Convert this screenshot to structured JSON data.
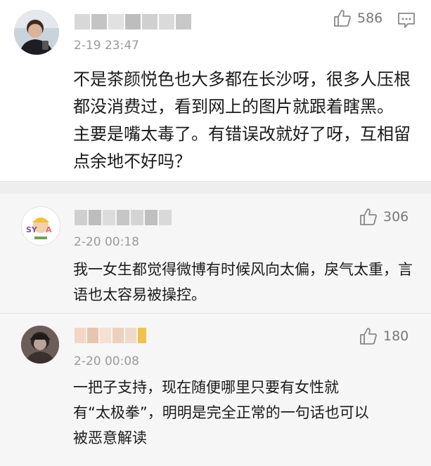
{
  "main_comment": {
    "time": "2-19 23:47",
    "likes": "586",
    "text": "不是茶颜悦色也大多都在长沙呀，很多人压根都没消费过，看到网上的图片就跟着瞎黑。 主要是嘴太毒了。有错误改就好了呀，互相留点余地不好吗？",
    "avatar_icon": "user-avatar-icon",
    "like_icon": "thumbs-up-icon",
    "comment_icon": "comment-more-icon"
  },
  "replies": [
    {
      "time": "2-20 00:18",
      "likes": "306",
      "text": "我一女生都觉得微博有时候风向太偏，戾气太重，言语也太容易被操控。",
      "avatar_icon": "sticker-avatar-icon"
    },
    {
      "time": "2-20 00:08",
      "likes": "180",
      "text": "一把子支持，现在随便哪里只要有女性就有“太极拳”，明明是完全正常的一句话也可以被恶意解读",
      "avatar_icon": "user-avatar-icon"
    }
  ],
  "colors": {
    "muted_text": "#9a9a9a",
    "reply_background": "#f6f6f6",
    "divider": "#eeeeee"
  }
}
